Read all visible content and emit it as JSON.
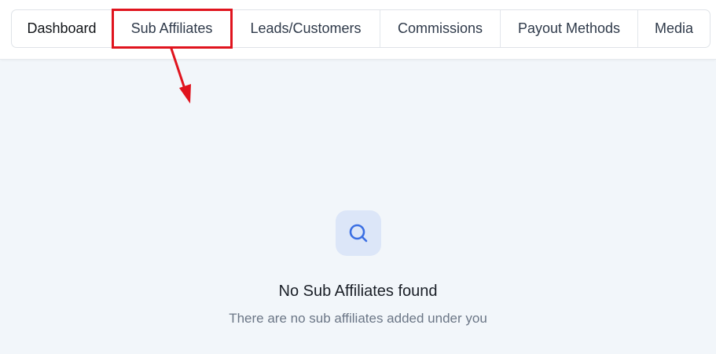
{
  "tabs": [
    {
      "label": "Dashboard"
    },
    {
      "label": "Sub Affiliates"
    },
    {
      "label": "Leads/Customers"
    },
    {
      "label": "Commissions"
    },
    {
      "label": "Payout Methods"
    },
    {
      "label": "Media"
    }
  ],
  "empty_state": {
    "icon": "search-icon",
    "title": "No Sub Affiliates found",
    "subtitle": "There are no sub affiliates added under you"
  },
  "colors": {
    "annotation": "#e0141e",
    "accent": "#3b6fe3",
    "icon_bg": "#dce6f8",
    "page_bg": "#f2f6fa"
  }
}
